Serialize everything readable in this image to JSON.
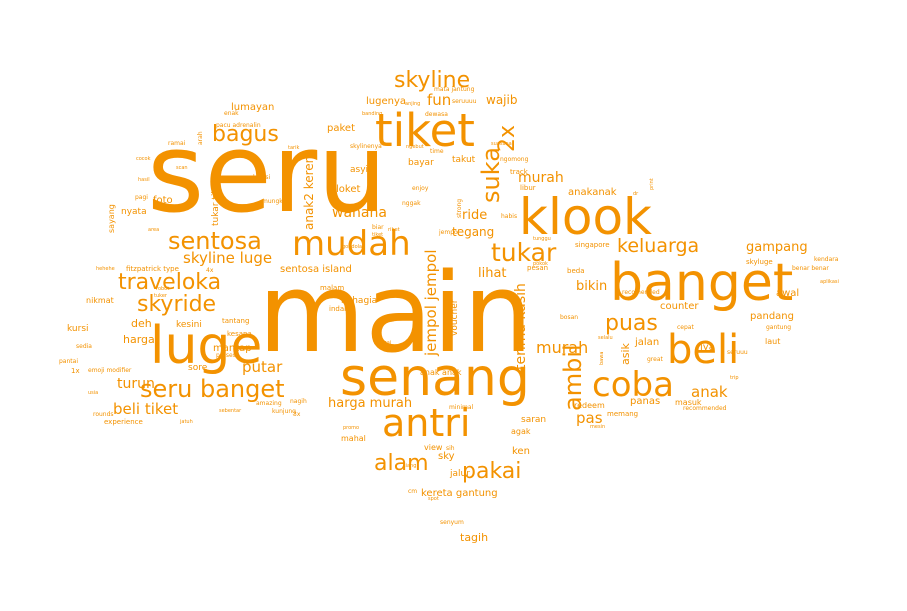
{
  "colors": {
    "word": "#f39200",
    "background": "#ffffff"
  },
  "words": {
    "main": "main",
    "seru": "seru",
    "senang": "senang",
    "klook": "klook",
    "banget": "banget",
    "tiket": "tiket",
    "luge": "luge",
    "beli": "beli",
    "mudah": "mudah",
    "antri": "antri",
    "coba": "coba",
    "sentosa": "sentosa",
    "traveloka": "traveloka",
    "seru_banget": "seru banget",
    "skyline": "skyline",
    "skyride": "skyride",
    "bagus": "bagus",
    "skyline_luge": "skyline luge",
    "keluarga": "keluarga",
    "tukar": "tukar",
    "alam": "alam",
    "pakai": "pakai",
    "puas": "puas",
    "ambil": "ambil",
    "suka": "suka",
    "twox": "2x",
    "beli_tiket": "beli tiket",
    "turun": "turun",
    "putar": "putar",
    "harga_murah": "harga murah",
    "anak": "anak",
    "pas": "pas",
    "murah": "murah",
    "jempol_jempol": "jempol jempol",
    "terima_kasih": "terima kasih",
    "gampang": "gampang",
    "wahana": "wahana",
    "sentosa_island": "sentosa island",
    "anak2_keren": "anak2 keren",
    "ride": "ride",
    "tegang": "tegang",
    "bikin": "bikin",
    "lihat": "lihat",
    "anakanak": "anakanak",
    "fun": "fun",
    "wajib": "wajib",
    "lugenya": "lugenya",
    "paket": "paket",
    "asyik": "asyik",
    "loket": "loket",
    "lumayan": "lumayan",
    "foto": "foto",
    "nyata": "nyata",
    "harga": "harga",
    "deh": "deh",
    "kesini": "kesini",
    "bahagia": "bahagia",
    "pandang": "pandang",
    "counter": "counter",
    "iya": "iya",
    "jalan": "jalan",
    "asik": "asik",
    "panas": "panas",
    "masuk": "masuk",
    "awal": "awal",
    "voucher": "voucher",
    "saran": "saran",
    "ken": "ken",
    "sky": "sky",
    "jalur": "jalur",
    "kereta_gantung": "kereta gantung",
    "tagih": "tagih",
    "mantap": "mantap",
    "sore": "sore",
    "tukar_tiket": "tukar tiket",
    "takut": "takut",
    "bayar": "bayar",
    "kursi": "kursi",
    "sayang": "sayang",
    "nikmat": "nikmat",
    "fitzpatrick_type": "fitzpatrick type",
    "mata_jantung": "mata jantung",
    "seruuuu": "seruuuu",
    "pacu_adrenalin": "pacu adrenalin",
    "anak_anak": "anak anak",
    "tantang": "tantang",
    "kesana": "kesana",
    "redeem": "redeem",
    "memang": "memang",
    "agak": "agak",
    "mahal": "mahal",
    "view": "view",
    "laut": "laut",
    "seruuu": "seruuu",
    "skyluge": "skyluge",
    "benar_benar": "benar benar",
    "experience": "experience",
    "emoji_modifier": "emoji modifier",
    "recomended": "recomended",
    "singapore": "singapore",
    "pesan": "pesan",
    "beda": "beda",
    "bosan": "bosan",
    "libur": "libur",
    "habis": "habis",
    "enjoy": "enjoy",
    "strong": "strong",
    "nggak": "nggak",
    "malam": "malam",
    "indah": "indah",
    "mungkin": "mungkin",
    "skylinenya": "skylinenya",
    "dewasa": "dewasa",
    "track": "track",
    "time": "time",
    "enak": "enak",
    "ramai": "ramai",
    "arah": "arah",
    "amazing": "amazing",
    "kunjung": "kunjung",
    "nagih": "nagih",
    "pantai": "pantai",
    "sedia": "sedia",
    "onex": "1x",
    "minimal": "minimal",
    "recommended": "recommended",
    "gantung": "gantung",
    "cepat": "cepat",
    "cm": "cm",
    "senyum": "senyum",
    "lokasi": "lokasi",
    "kendara": "kendara",
    "aplikasi": "aplikasi",
    "hasil": "hasil",
    "pagi": "pagi",
    "cocok": "cocok",
    "scan": "scan",
    "tarik": "tarik",
    "banding": "banding",
    "anjing": "anjing",
    "dr": "dr",
    "print": "print",
    "proses": "proses",
    "sebentar": "sebentar",
    "rounds": "rounds",
    "jatuh": "jatuh",
    "great": "great",
    "trip": "trip",
    "ngomong": "ngomong",
    "usia": "usia",
    "area": "area",
    "hehehe": "hehehe",
    "fourx": "4x",
    "robot": "robot",
    "tuker": "tuker",
    "sih": "sih",
    "gondola": "gondola",
    "biar": "biar",
    "tiket_small": "tiket",
    "threex": "3x",
    "ngebut": "ngebut",
    "tunggu": "tunggu",
    "pokok": "pokok",
    "selalu": "selalu",
    "bawa": "bawa",
    "siang": "siang",
    "spot": "spot",
    "mesin": "mesin",
    "ribet": "ribet",
    "serem": "serem",
    "promo": "promo",
    "jempol_small": "jempol",
    "selesai": "selesai",
    "suasana": "suasana"
  }
}
